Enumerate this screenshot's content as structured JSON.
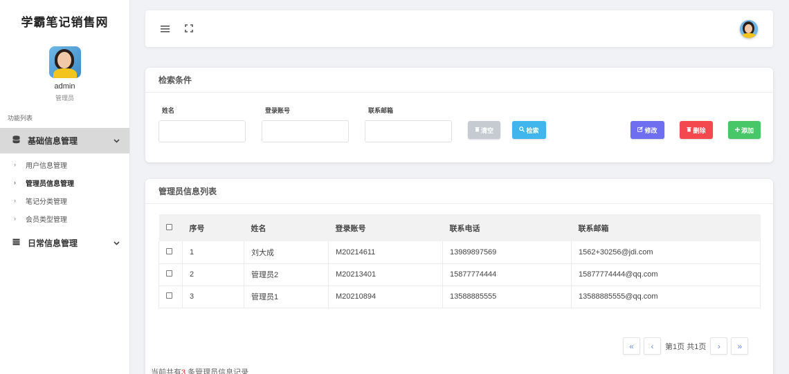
{
  "sidebar": {
    "brand": "学霸笔记销售网",
    "user_name": "admin",
    "user_role": "管理员",
    "menu_title": "功能列表",
    "groups": [
      {
        "label": "基础信息管理",
        "icon": "database-icon",
        "items": [
          "用户信息管理",
          "管理员信息管理",
          "笔记分类管理",
          "会员类型管理"
        ]
      },
      {
        "label": "日常信息管理",
        "icon": "server-icon",
        "items": []
      }
    ]
  },
  "topbar": {
    "menu_icon": "≡",
    "fullscreen_icon": "⛶"
  },
  "search": {
    "title": "检索条件",
    "fields": [
      {
        "label": "姓名",
        "value": ""
      },
      {
        "label": "登录账号",
        "value": ""
      },
      {
        "label": "联系邮箱",
        "value": ""
      }
    ],
    "buttons": {
      "clear": "清空",
      "search": "检索",
      "edit": "修改",
      "delete": "删除",
      "add": "添加"
    }
  },
  "list": {
    "title": "管理员信息列表",
    "columns": [
      "序号",
      "姓名",
      "登录账号",
      "联系电话",
      "联系邮箱"
    ],
    "rows": [
      {
        "no": "1",
        "name": "刘大成",
        "account": "M20214611",
        "phone": "13989897569",
        "email": "1562+30256@jdi.com"
      },
      {
        "no": "2",
        "name": "管理员2",
        "account": "M20213401",
        "phone": "15877774444",
        "email": "15877774444@qq.com"
      },
      {
        "no": "3",
        "name": "管理员1",
        "account": "M20210894",
        "phone": "13588885555",
        "email": "13588885555@qq.com"
      }
    ]
  },
  "pager": {
    "first": "«",
    "prev": "‹",
    "next": "›",
    "last": "»",
    "page_pre": "第",
    "page_num": "1",
    "page_suf": "页",
    "total_pre": "共",
    "total_num": "1",
    "total_suf": "页"
  },
  "footer": {
    "pre": "当前共有",
    "count": "3",
    "post": " 条管理员信息记录"
  }
}
